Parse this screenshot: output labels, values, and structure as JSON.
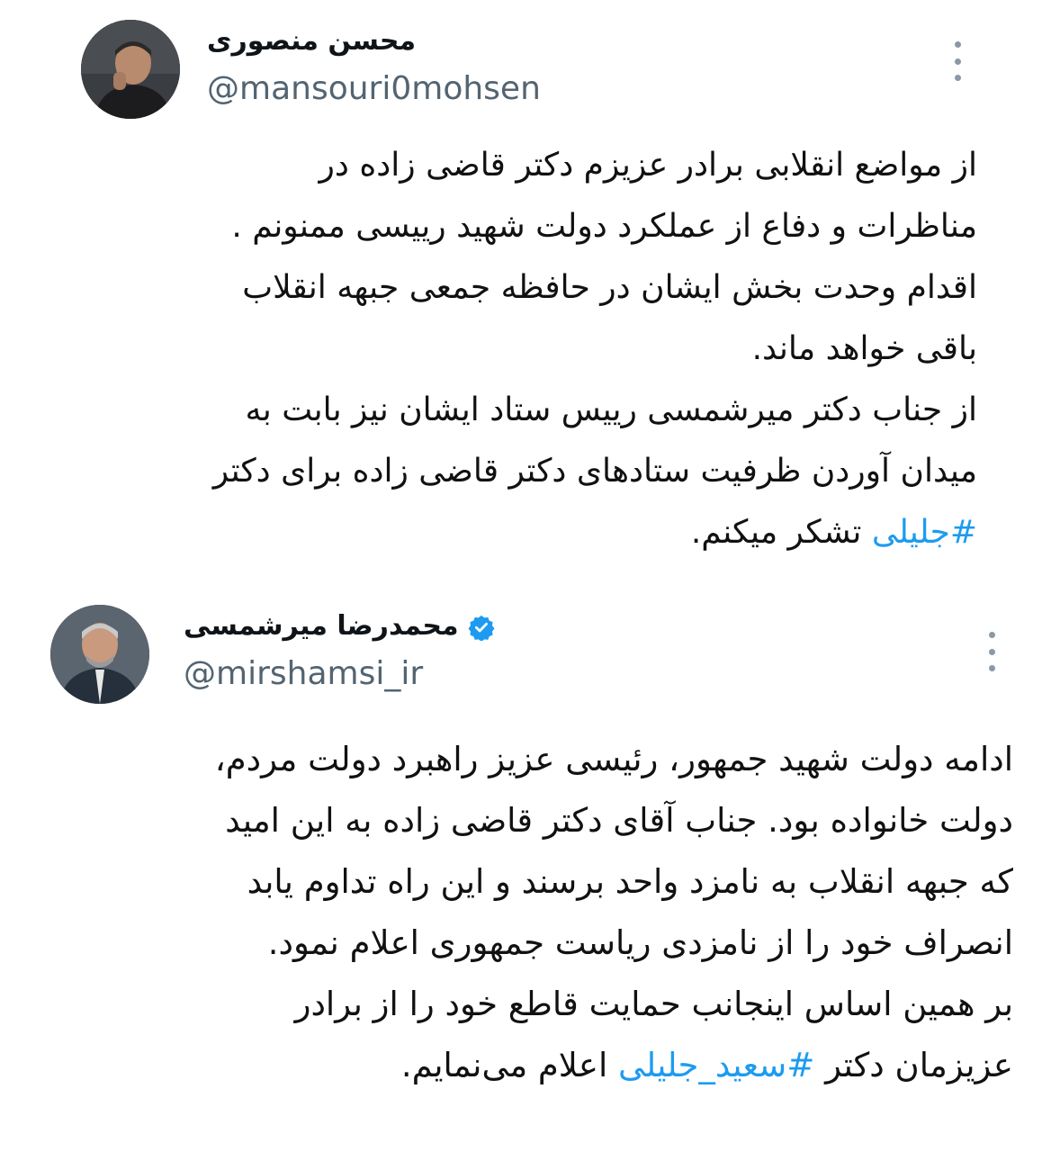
{
  "tweets": [
    {
      "author": {
        "display_name": "محسن منصوری",
        "handle": "@mansouri0mohsen",
        "avatar_icon": "avatar-photo-mansouri"
      },
      "more_icon": "more-vertical-icon",
      "lines": [
        {
          "text": "از مواضع انقلابی برادر عزیزم دکتر قاضی زاده در"
        },
        {
          "text": "مناظرات و دفاع از عملکرد دولت شهید رییسی ممنونم ."
        },
        {
          "text": "اقدام وحدت بخش ایشان در حافظه جمعی جبهه انقلاب"
        },
        {
          "text": "باقی خواهد ماند."
        },
        {
          "text": "از جناب دکتر میرشمسی رییس ستاد ایشان نیز بابت به"
        },
        {
          "text": "میدان آوردن ظرفیت ستادهای دکتر قاضی زاده برای دکتر"
        },
        {
          "hashtag": "#جلیلی",
          "text": " تشکر میکنم."
        }
      ]
    },
    {
      "author": {
        "display_name": "محمدرضا میرشمسی",
        "handle": "@mirshamsi_ir",
        "verified": true,
        "avatar_icon": "avatar-photo-mirshamsi"
      },
      "more_icon": "more-vertical-icon",
      "lines": [
        {
          "text": "ادامه دولت شهید جمهور، رئیسی عزیز راهبرد دولت مردم،"
        },
        {
          "text": "دولت خانواده بود. جناب آقای دکتر قاضی زاده به این امید"
        },
        {
          "text": "که جبهه انقلاب به نامزد واحد برسند و این راه تداوم یابد"
        },
        {
          "text": "انصراف خود را از نامزدی ریاست جمهوری اعلام نمود."
        },
        {
          "text": "بر همین اساس اینجانب حمایت قاطع خود را از برادر"
        },
        {
          "prefix": "عزیزمان دکتر ",
          "hashtag": "#سعید_جلیلی",
          "text": " اعلام می‌نمایم."
        }
      ]
    }
  ],
  "colors": {
    "hashtag": "#1d9bf0",
    "handle": "#536471",
    "verified": "#1d9bf0",
    "icon": "#8b98a5"
  }
}
